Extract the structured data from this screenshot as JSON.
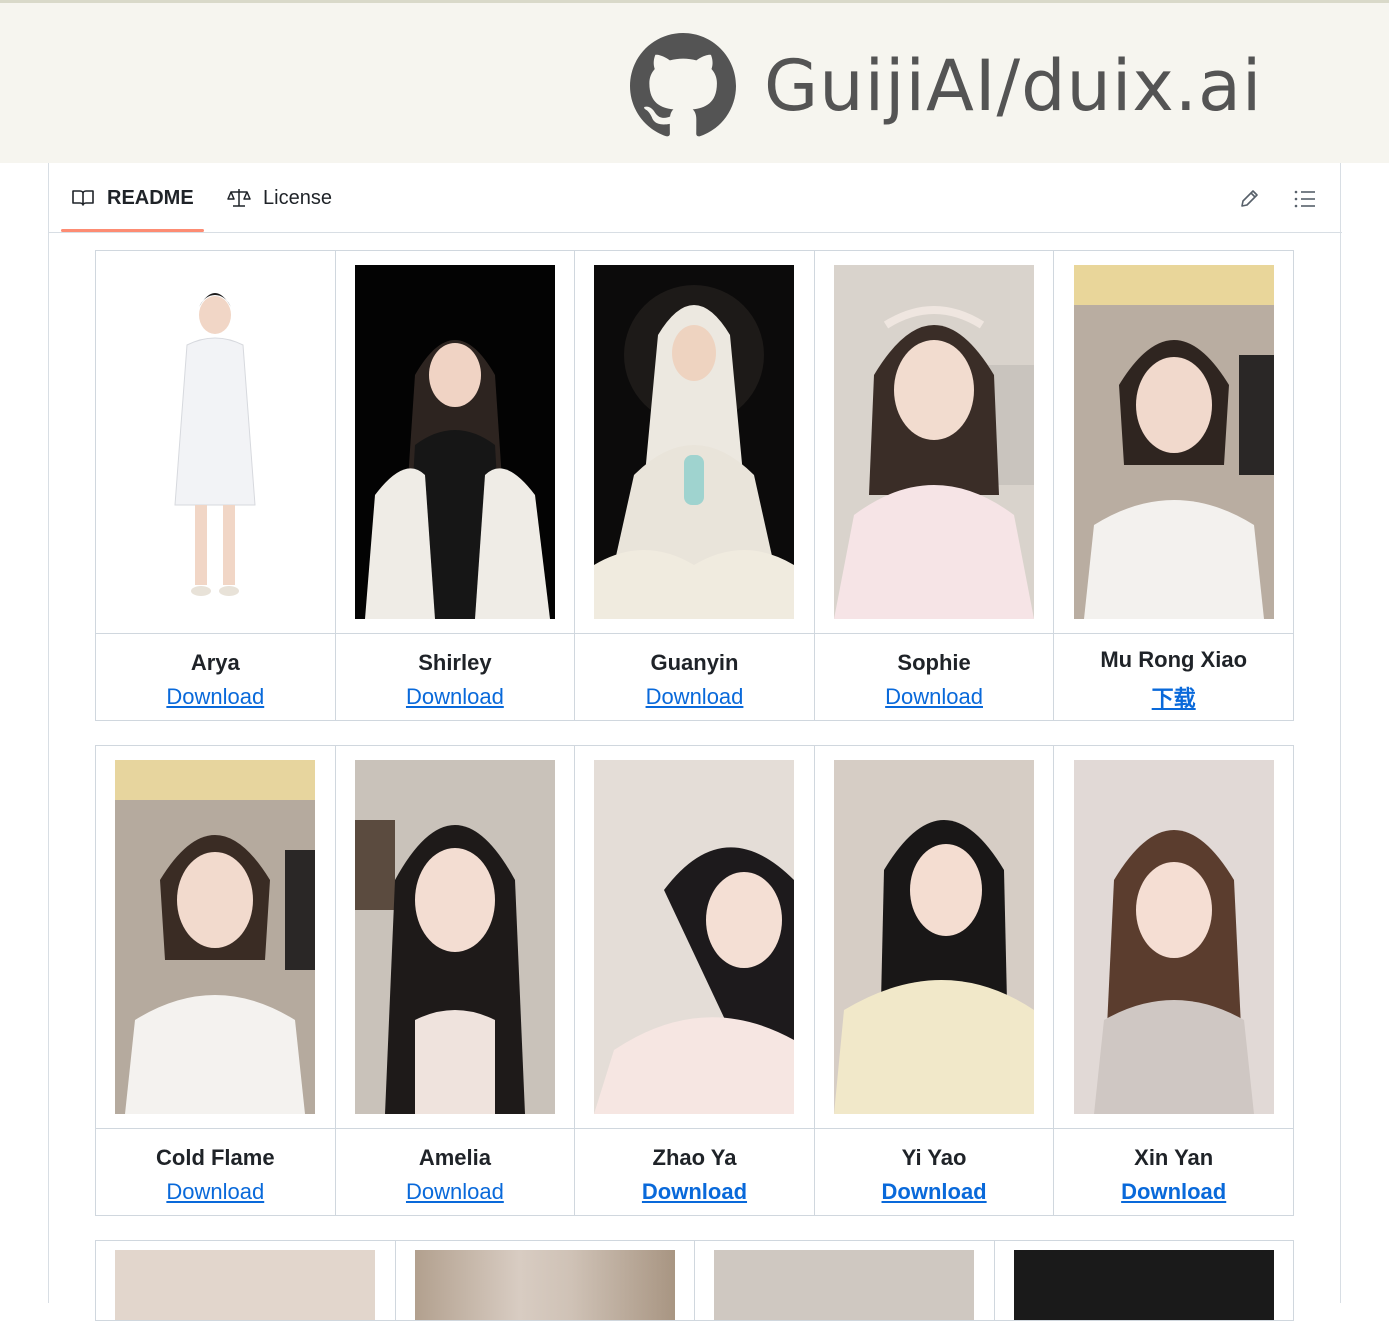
{
  "header": {
    "repo": "GuijiAI/duix.ai",
    "logo_icon": "github-icon"
  },
  "tabs": [
    {
      "label": "README",
      "icon": "book-icon",
      "active": true
    },
    {
      "label": "License",
      "icon": "scale-icon",
      "active": false
    }
  ],
  "toolbar": {
    "edit_icon": "pencil-icon",
    "toc_icon": "list-icon"
  },
  "colors": {
    "accent": "#fd8c73",
    "link": "#0969da",
    "header_bg": "#f6f5ef"
  },
  "avatars_row1": [
    {
      "name": "Arya",
      "link": "Download"
    },
    {
      "name": "Shirley",
      "link": "Download"
    },
    {
      "name": "Guanyin",
      "link": "Download"
    },
    {
      "name": "Sophie",
      "link": "Download"
    },
    {
      "name": "Mu Rong Xiao",
      "link": "下载"
    }
  ],
  "avatars_row2": [
    {
      "name": "Cold Flame",
      "link": "Download"
    },
    {
      "name": "Amelia",
      "link": "Download"
    },
    {
      "name": "Zhao Ya",
      "link": "Download"
    },
    {
      "name": "Yi Yao",
      "link": "Download"
    },
    {
      "name": "Xin Yan",
      "link": "Download"
    }
  ]
}
